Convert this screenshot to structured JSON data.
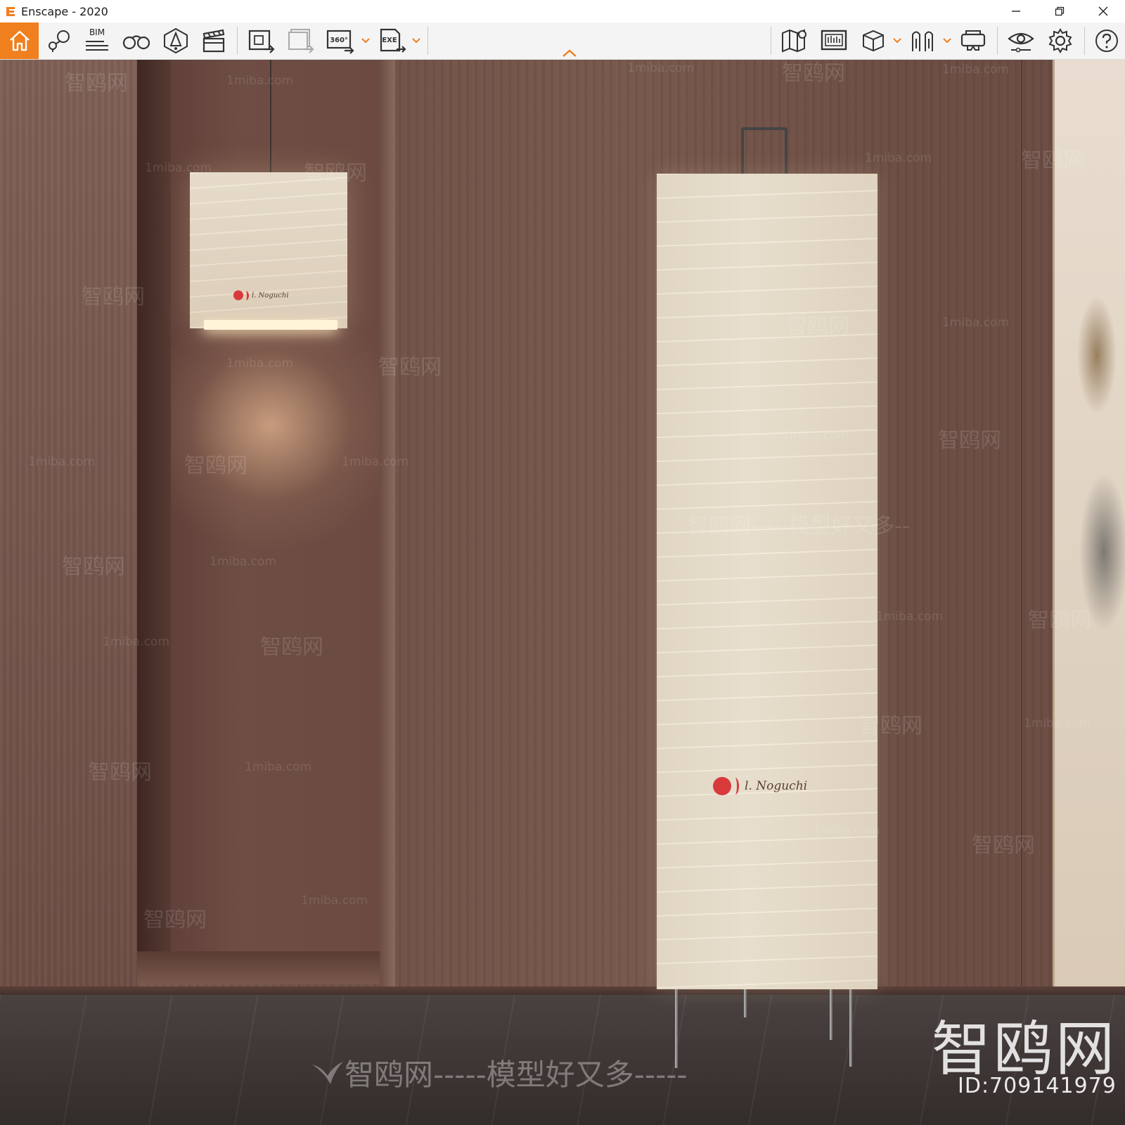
{
  "window": {
    "title": "Enscape - 2020",
    "accent_color": "#f07f1e"
  },
  "toolbar": {
    "home": {
      "icon": "home-icon"
    },
    "buttons": [
      {
        "id": "bookmarks",
        "icon": "map-pin-icon"
      },
      {
        "id": "bim",
        "icon": "bim-icon",
        "label": "BIM"
      },
      {
        "id": "views",
        "icon": "binoculars-icon"
      },
      {
        "id": "materials",
        "icon": "material-editor-icon"
      },
      {
        "id": "video",
        "icon": "clapperboard-icon"
      },
      {
        "id": "screenshot",
        "icon": "render-export-icon"
      },
      {
        "id": "batch",
        "icon": "batch-render-icon"
      },
      {
        "id": "panorama",
        "icon": "panorama-icon",
        "label": "360°"
      },
      {
        "id": "exe",
        "icon": "exe-export-icon",
        "label": "EXE"
      },
      {
        "id": "minimap",
        "icon": "minimap-icon"
      },
      {
        "id": "render-view",
        "icon": "render-window-icon"
      },
      {
        "id": "asset",
        "icon": "asset-box-icon"
      },
      {
        "id": "walk",
        "icon": "people-icon"
      },
      {
        "id": "vr",
        "icon": "vr-headset-icon"
      },
      {
        "id": "visual",
        "icon": "eye-settings-icon"
      },
      {
        "id": "settings",
        "icon": "gear-icon"
      },
      {
        "id": "help",
        "icon": "help-icon"
      }
    ]
  },
  "viewport": {
    "lamp_signature": "l. Noguchi",
    "watermarks": {
      "brand": "智鸥网",
      "site": "1miba.com",
      "slogan": "模型好又多",
      "bottom_line": "智鸥网-----模型好又多-----",
      "mid_line": "智鸥网-----模型好又多--",
      "id_text": "ID:709141979"
    }
  }
}
